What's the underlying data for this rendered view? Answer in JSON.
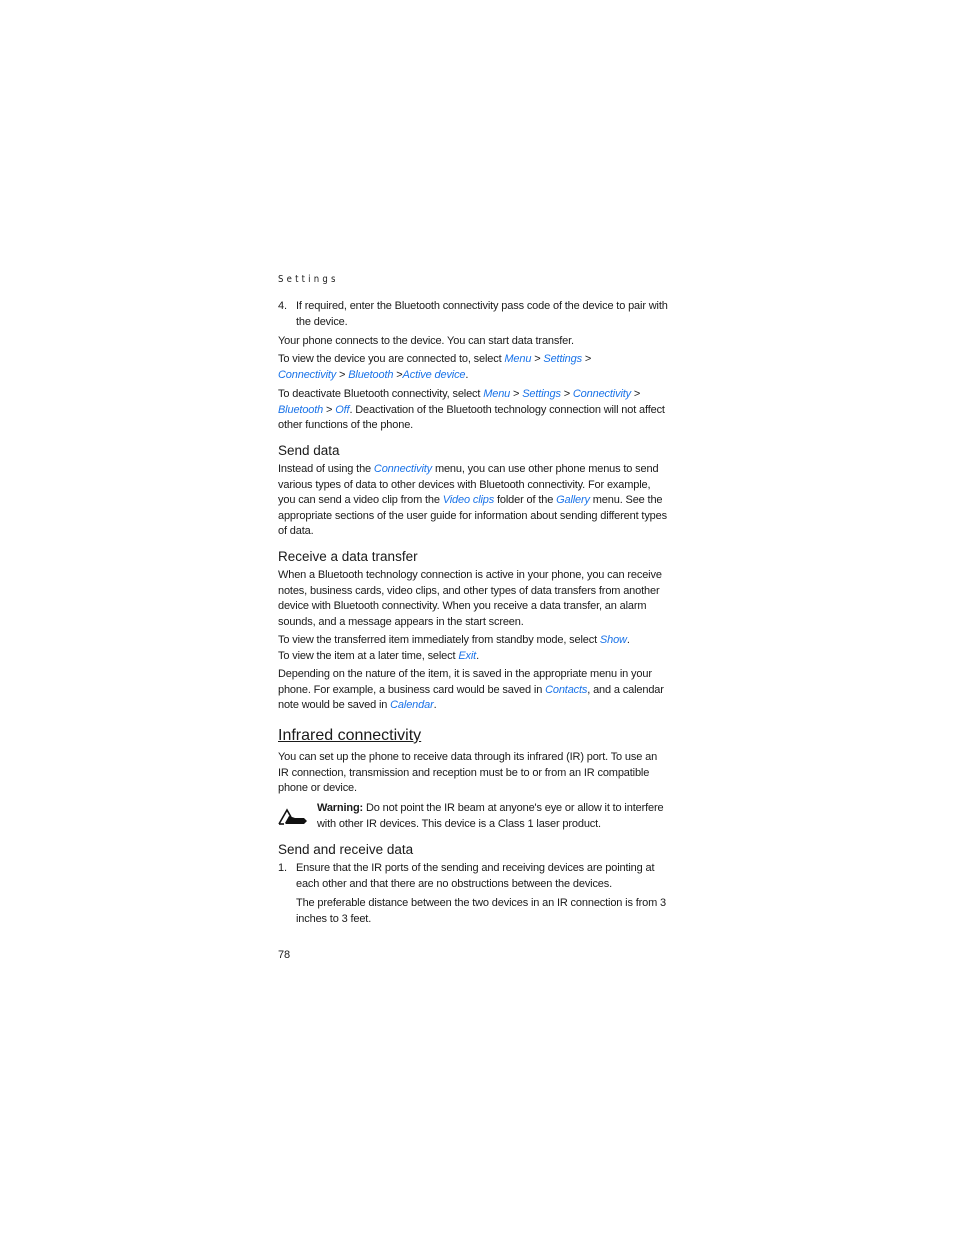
{
  "running_head": "Settings",
  "step4": {
    "number": "4.",
    "text": "If required, enter the Bluetooth connectivity pass code of the device to pair with the device."
  },
  "p_connects": "Your phone connects to the device. You can start data transfer.",
  "p_view_device": {
    "before": "To view the device you are connected to, select ",
    "menu": "Menu",
    "settings": "Settings",
    "connectivity": "Connectivity",
    "bluetooth": "Bluetooth",
    "active_device": "Active device",
    "sep": " > ",
    "end": "."
  },
  "p_deactivate": {
    "before": "To deactivate Bluetooth connectivity, select ",
    "menu": "Menu",
    "settings": "Settings",
    "connectivity": "Connectivity",
    "bluetooth": "Bluetooth",
    "off": "Off",
    "after": ". Deactivation of the Bluetooth technology connection will not affect other functions of the phone."
  },
  "send_data": {
    "heading": "Send data",
    "t1": "Instead of using the ",
    "connectivity": "Connectivity",
    "t2": " menu, you can use other phone menus to send various types of data to other devices with Bluetooth connectivity. For example, you can send a video clip from the ",
    "video_clips": "Video clips",
    "t3": " folder of the ",
    "gallery": "Gallery",
    "t4": " menu. See the appropriate sections of the user guide for information about sending different types of data."
  },
  "receive": {
    "heading": "Receive a data transfer",
    "p1": "When a Bluetooth technology connection is active in your phone, you can receive notes, business cards, video clips, and other types of data transfers from another device with Bluetooth connectivity. When you receive a data transfer, an alarm sounds, and a message appears in the start screen.",
    "p2a": "To view the transferred item immediately from standby mode, select ",
    "show": "Show",
    "p2b": "To view the item at a later time, select ",
    "exit": "Exit",
    "p3a": "Depending on the nature of the item, it is saved in the appropriate menu in your phone. For example, a business card would be saved in ",
    "contacts": "Contacts",
    "p3b": ", and a calendar note would be saved in ",
    "calendar": "Calendar",
    "dot": "."
  },
  "infrared": {
    "heading": "Infrared connectivity",
    "p1": "You can set up the phone to receive data through its infrared (IR) port. To use an IR connection, transmission and reception must be to or from an IR compatible phone or device.",
    "warning_label": "Warning:",
    "warning_text": " Do not point the IR beam at anyone's eye or allow it to interfere with other IR devices. This device is a Class 1 laser product.",
    "warning_icon": "warning-hand-icon"
  },
  "send_receive": {
    "heading": "Send and receive data",
    "step1_number": "1.",
    "step1_text": "Ensure that the IR ports of the sending and receiving devices are pointing at each other and that there are no obstructions between the devices.",
    "step1_note": "The preferable distance between the two devices in an IR connection is from 3 inches to 3 feet."
  },
  "page_number": "78",
  "colors": {
    "link": "#1a73e8",
    "text": "#1a1a1a"
  }
}
